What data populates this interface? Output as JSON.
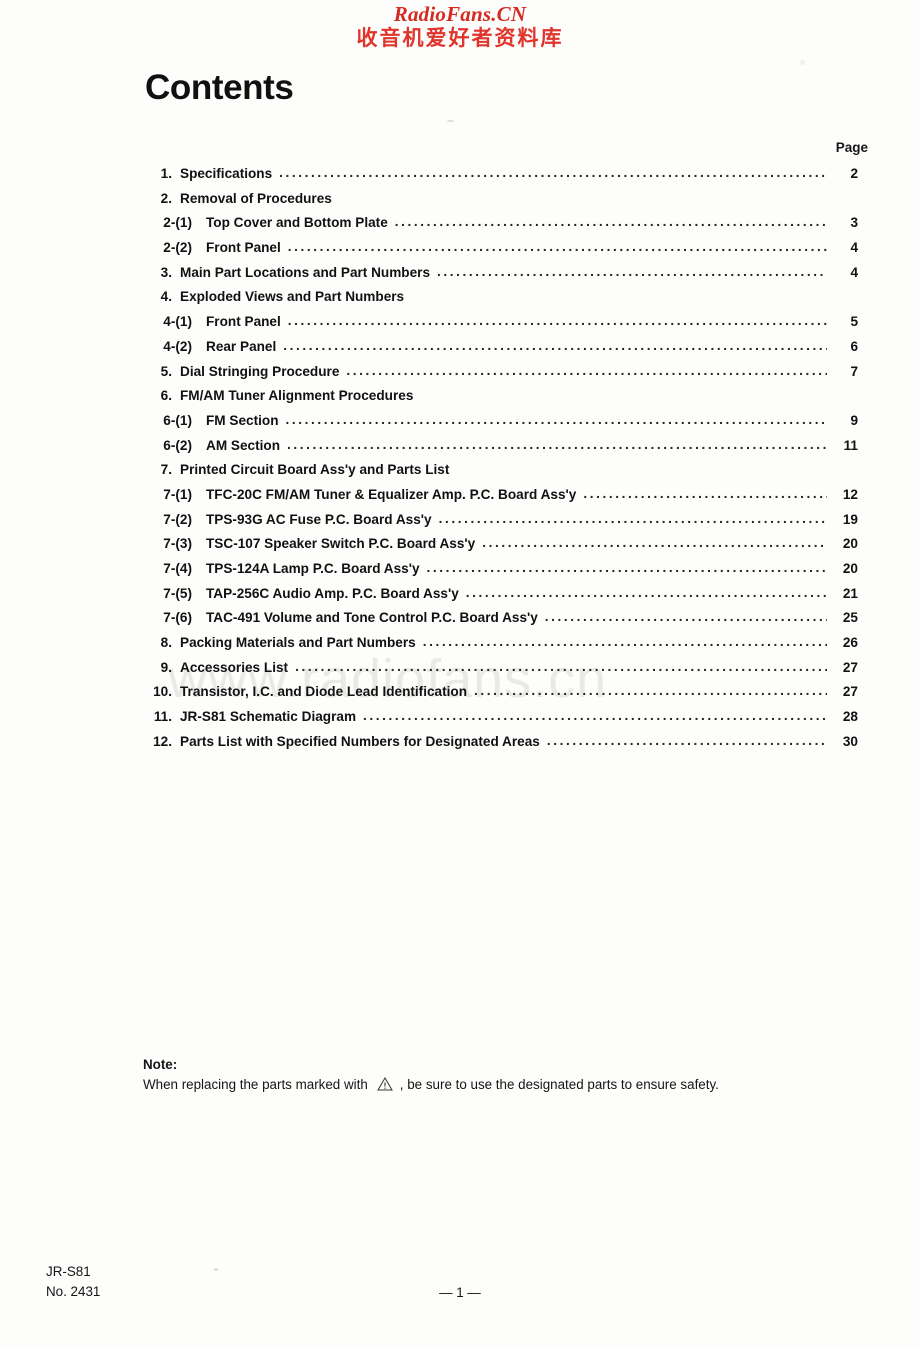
{
  "banner": {
    "latin": "RadioFans.CN",
    "cjk": "收音机爱好者资料库",
    "color": "#d42a22"
  },
  "title": "Contents",
  "page_column_header": "Page",
  "watermark": "www.radiofans.cn",
  "toc": {
    "entries": [
      {
        "level": 1,
        "num": "1.",
        "label": "Specifications",
        "page": "2"
      },
      {
        "level": 1,
        "num": "2.",
        "label": "Removal of Procedures",
        "page": ""
      },
      {
        "level": 2,
        "num": "2-(1)",
        "label": "Top Cover and Bottom Plate",
        "page": "3"
      },
      {
        "level": 2,
        "num": "2-(2)",
        "label": "Front Panel",
        "page": "4"
      },
      {
        "level": 1,
        "num": "3.",
        "label": "Main Part Locations and Part Numbers",
        "page": "4"
      },
      {
        "level": 1,
        "num": "4.",
        "label": "Exploded Views and Part Numbers",
        "page": ""
      },
      {
        "level": 2,
        "num": "4-(1)",
        "label": "Front Panel",
        "page": "5"
      },
      {
        "level": 2,
        "num": "4-(2)",
        "label": "Rear Panel",
        "page": "6"
      },
      {
        "level": 1,
        "num": "5.",
        "label": "Dial Stringing Procedure",
        "page": "7"
      },
      {
        "level": 1,
        "num": "6.",
        "label": "FM/AM Tuner Alignment Procedures",
        "page": ""
      },
      {
        "level": 2,
        "num": "6-(1)",
        "label": "FM Section",
        "page": "9"
      },
      {
        "level": 2,
        "num": "6-(2)",
        "label": "AM Section",
        "page": "11"
      },
      {
        "level": 1,
        "num": "7.",
        "label": "Printed Circuit Board Ass'y and Parts List",
        "page": ""
      },
      {
        "level": 2,
        "num": "7-(1)",
        "label": "TFC-20C  FM/AM Tuner & Equalizer Amp. P.C. Board Ass'y",
        "page": "12"
      },
      {
        "level": 2,
        "num": "7-(2)",
        "label": "TPS-93G  AC Fuse P.C. Board Ass'y",
        "page": "19"
      },
      {
        "level": 2,
        "num": "7-(3)",
        "label": "TSC-107  Speaker Switch P.C. Board Ass'y",
        "page": "20"
      },
      {
        "level": 2,
        "num": "7-(4)",
        "label": "TPS-124A  Lamp P.C. Board Ass'y",
        "page": "20"
      },
      {
        "level": 2,
        "num": "7-(5)",
        "label": "TAP-256C  Audio Amp. P.C. Board Ass'y",
        "page": "21"
      },
      {
        "level": 2,
        "num": "7-(6)",
        "label": "TAC-491  Volume and Tone Control P.C. Board Ass'y",
        "page": "25"
      },
      {
        "level": 1,
        "num": "8.",
        "label": "Packing Materials and Part Numbers",
        "page": "26"
      },
      {
        "level": 1,
        "num": "9.",
        "label": "Accessories List",
        "page": "27"
      },
      {
        "level": 1,
        "num": "10.",
        "label": "Transistor, I.C. and Diode Lead Identification",
        "page": "27"
      },
      {
        "level": 1,
        "num": "11.",
        "label": "JR-S81 Schematic Diagram",
        "page": "28"
      },
      {
        "level": 1,
        "num": "12.",
        "label": "Parts List with Specified Numbers for Designated Areas",
        "page": "30"
      }
    ]
  },
  "note": {
    "heading": "Note:",
    "text_before": "When replacing the parts marked with",
    "icon": "warning-triangle-icon",
    "text_after": ", be sure to use the designated parts to ensure safety."
  },
  "footer": {
    "model": "JR-S81",
    "doc_no": "No. 2431",
    "page_marker": "— 1 —"
  }
}
